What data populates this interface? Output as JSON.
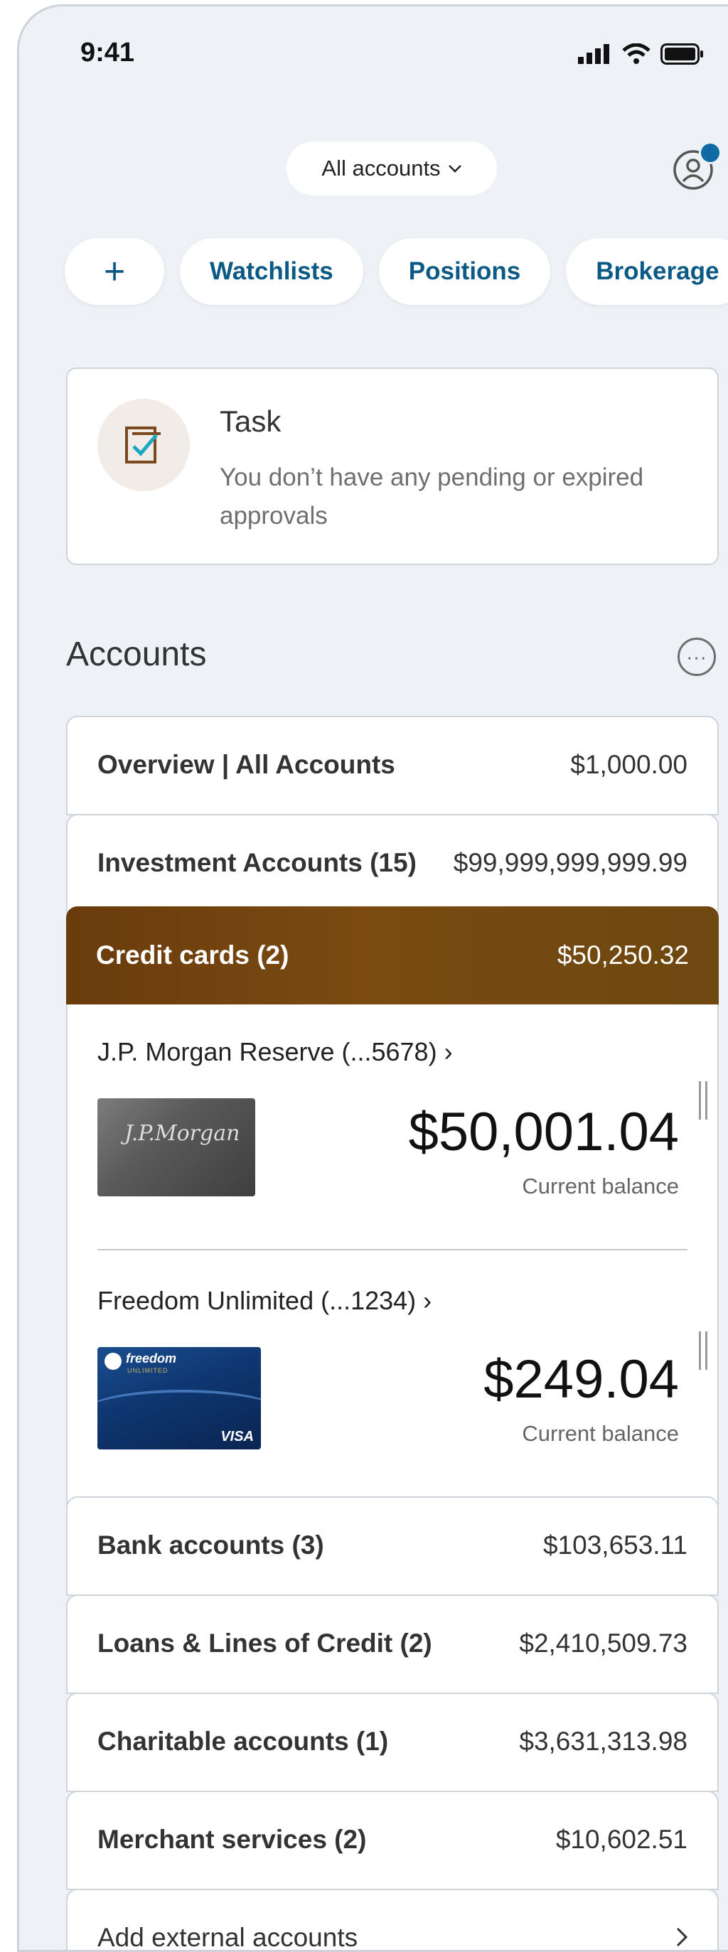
{
  "status_bar": {
    "time": "9:41"
  },
  "header": {
    "account_selector": "All accounts"
  },
  "chips": [
    {
      "label": "+"
    },
    {
      "label": "Watchlists"
    },
    {
      "label": "Positions"
    },
    {
      "label": "Brokerage"
    }
  ],
  "task": {
    "title": "Task",
    "description": "You don’t have any pending or expired approvals"
  },
  "accounts": {
    "title": "Accounts",
    "more_label": "···",
    "overview": {
      "label": "Overview | All Accounts",
      "amount": "$1,000.00"
    },
    "investment": {
      "label": "Investment Accounts (15)",
      "amount": "$99,999,999,999.99"
    },
    "credit_cards": {
      "label": "Credit cards (2)",
      "amount": "$50,250.32",
      "cards": [
        {
          "name": "J.P. Morgan Reserve (...5678) ›",
          "balance": "$50,001.04",
          "balance_label": "Current balance",
          "card_script": "J.P.Morgan"
        },
        {
          "name": "Freedom Unlimited (...1234) ›",
          "balance": "$249.04",
          "balance_label": "Current balance",
          "card_brand": "freedom",
          "card_sub": "UNLIMITED",
          "network": "VISA"
        }
      ]
    },
    "bank": {
      "label": "Bank accounts (3)",
      "amount": "$103,653.11"
    },
    "loans": {
      "label": "Loans & Lines of Credit (2)",
      "amount": "$2,410,509.73"
    },
    "charitable": {
      "label": "Charitable accounts (1)",
      "amount": "$3,631,313.98"
    },
    "merchant": {
      "label": "Merchant services (2)",
      "amount": "$10,602.51"
    },
    "add_external": {
      "label": "Add external accounts"
    }
  },
  "colors": {
    "accent": "#0b5a85",
    "credit_header": "#6a3c0c",
    "background": "#eef2f6"
  }
}
